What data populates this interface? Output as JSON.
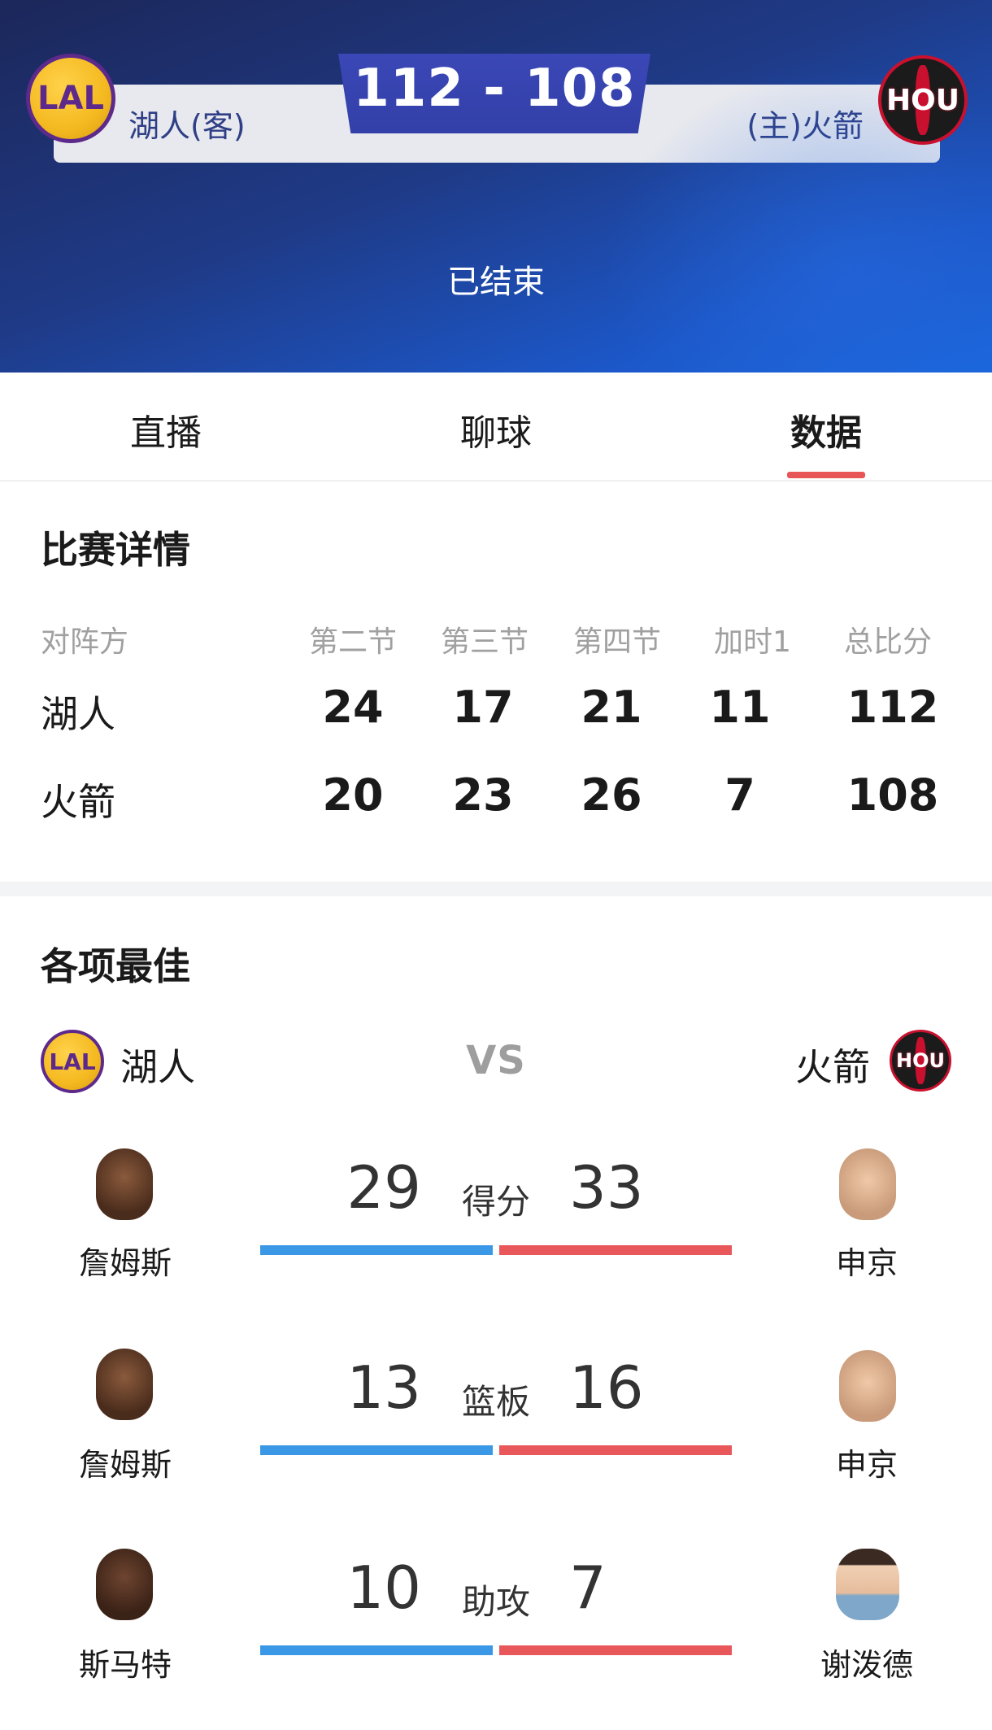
{
  "header": {
    "away_team": "湖人(客)",
    "home_team": "(主)火箭",
    "score": "112 - 108",
    "status": "已结束",
    "away_logo_text": "LAL",
    "home_logo_text": "HOU"
  },
  "tabs": [
    {
      "label": "直播",
      "active": false
    },
    {
      "label": "聊球",
      "active": false
    },
    {
      "label": "数据",
      "active": true
    }
  ],
  "match_details": {
    "title": "比赛详情",
    "columns": [
      "对阵方",
      "第二节",
      "第三节",
      "第四节",
      "加时1",
      "总比分"
    ],
    "rows": [
      {
        "team": "湖人",
        "scores": [
          "24",
          "17",
          "21",
          "11",
          "112"
        ]
      },
      {
        "team": "火箭",
        "scores": [
          "20",
          "23",
          "26",
          "7",
          "108"
        ]
      }
    ]
  },
  "leaders": {
    "title": "各项最佳",
    "left_team": "湖人",
    "right_team": "火箭",
    "vs": "VS",
    "stats": [
      {
        "label": "得分",
        "left_value": "29",
        "right_value": "33",
        "left_player": "詹姆斯",
        "right_player": "申京"
      },
      {
        "label": "篮板",
        "left_value": "13",
        "right_value": "16",
        "left_player": "詹姆斯",
        "right_player": "申京"
      },
      {
        "label": "助攻",
        "left_value": "10",
        "right_value": "7",
        "left_player": "斯马特",
        "right_player": "谢泼德"
      }
    ]
  },
  "colors": {
    "header_dark": "#1c275a",
    "header_blue": "#1a66db",
    "score_box": "#3a47b6",
    "accent_red": "#e85557",
    "bar_blue": "#3b98e6",
    "bar_red": "#e8575a",
    "lakers_gold": "#f4b920",
    "lakers_purple": "#5d2a8c",
    "rockets_red": "#c9102e"
  }
}
